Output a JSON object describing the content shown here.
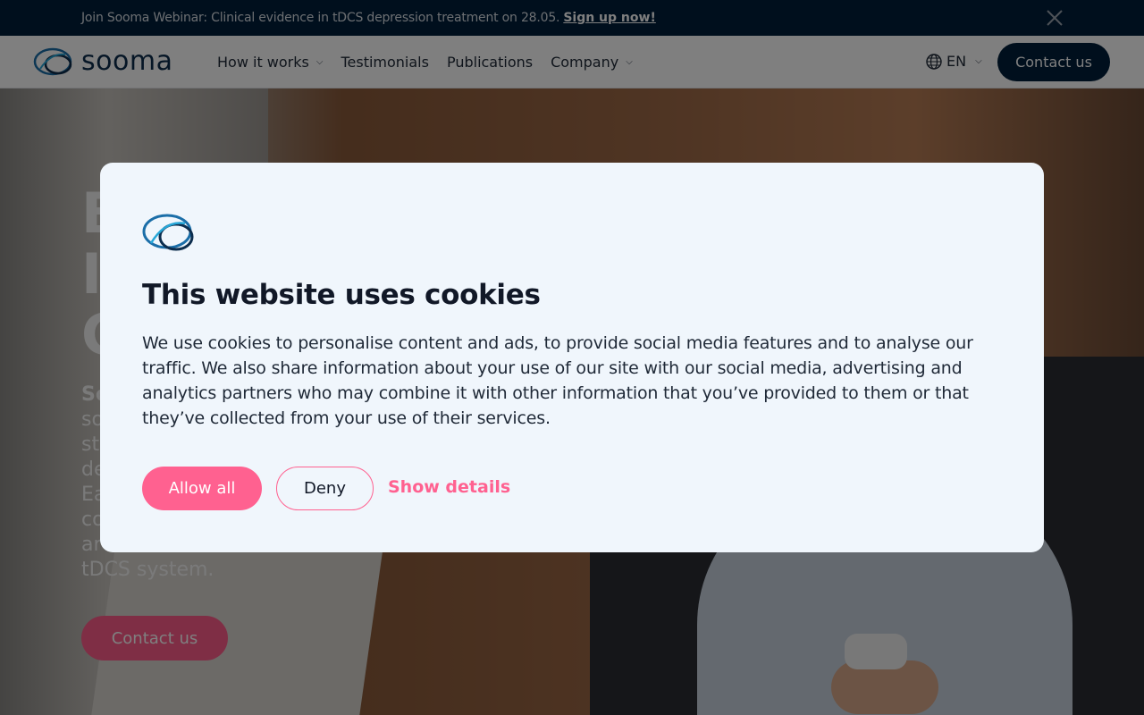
{
  "announcement": {
    "text": "Join Sooma Webinar: Clinical evidence in tDCS depression treatment on 28.05.",
    "link": "Sign up now!"
  },
  "header": {
    "logo_text": "sooma",
    "nav": [
      {
        "label": "How it works",
        "has_dropdown": true
      },
      {
        "label": "Testimonials",
        "has_dropdown": false
      },
      {
        "label": "Publications",
        "has_dropdown": false
      },
      {
        "label": "Company",
        "has_dropdown": true
      }
    ],
    "language": "EN",
    "contact_label": "Contact us"
  },
  "hero": {
    "title_lines": [
      "B",
      "I",
      "C"
    ],
    "body_lines": [
      "So",
      "so",
      "st",
      "de",
      "Ea",
      "co",
      "ar",
      "tDCS system."
    ],
    "cta": "Contact us"
  },
  "cookie_dialog": {
    "title": "This website uses cookies",
    "body": "We use cookies to personalise content and ads, to provide social media features and to analyse our traffic. We also share information about your use of our site with our social media, advertising and analytics partners who may combine it with other information that you’ve provided to them or that they’ve collected from your use of their services.",
    "allow_label": "Allow all",
    "deny_label": "Deny",
    "details_label": "Show details"
  },
  "colors": {
    "navy": "#011f3b",
    "pink": "#ff6190",
    "dialog_bg": "#f0f6fc"
  }
}
